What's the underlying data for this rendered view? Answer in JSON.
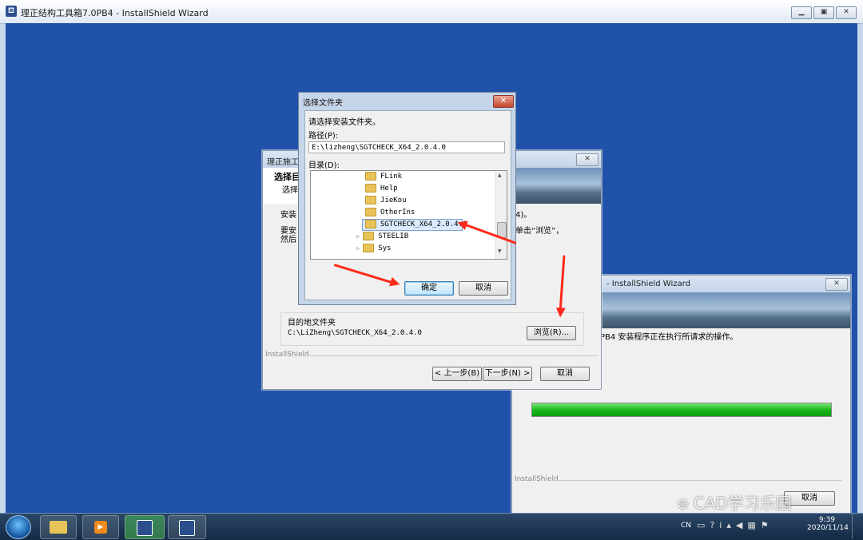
{
  "outer_window": {
    "title": "理正结构工具箱7.0PB4 - InstallShield Wizard",
    "icon": "app-icon",
    "controls": [
      "minimize",
      "restore",
      "close"
    ]
  },
  "wizard": {
    "title": "理正施工",
    "heading": "选择目",
    "subheading": "选择",
    "body_line1": "安装",
    "body_line1_tail": "4)。",
    "body_line2a": "要安",
    "body_line2b": "然后",
    "body_line2_tail": "单击“浏览”，",
    "dest_group_label": "目的地文件夹",
    "dest_path": "C:\\LiZheng\\SGTCHECK_X64_2.0.4.0",
    "browse_label": "浏览(R)...",
    "brand": "InstallShield",
    "back_label": "< 上一步(B)",
    "next_label": "下一步(N) >",
    "cancel_label": "取消"
  },
  "progress_window": {
    "title": "- InstallShield Wizard",
    "status": "PB4 安装程序正在执行所请求的操作。",
    "brand": "InstallShield",
    "progress_percent": 100,
    "cancel_label": "取消"
  },
  "folder_dialog": {
    "title": "选择文件夹",
    "prompt": "请选择安装文件夹。",
    "path_label": "路径(P):",
    "path_value": "E:\\lizheng\\SGTCHECK_X64_2.0.4.0",
    "dir_label": "目录(D):",
    "tree": [
      {
        "name": "FLink",
        "expandable": false,
        "selected": false
      },
      {
        "name": "Help",
        "expandable": false,
        "selected": false
      },
      {
        "name": "JieKou",
        "expandable": false,
        "selected": false
      },
      {
        "name": "OtherIns",
        "expandable": false,
        "selected": false
      },
      {
        "name": "SGTCHECK_X64_2.0.4.0",
        "expandable": false,
        "selected": true
      },
      {
        "name": "STEELIB",
        "expandable": true,
        "selected": false
      },
      {
        "name": "Sys",
        "expandable": true,
        "selected": false
      }
    ],
    "ok_label": "确定",
    "cancel_label": "取消"
  },
  "watermark": "CAD学习乐园",
  "taskbar": {
    "tray_lang": "CN",
    "clock_time": "9:39",
    "clock_date": "2020/11/14"
  }
}
